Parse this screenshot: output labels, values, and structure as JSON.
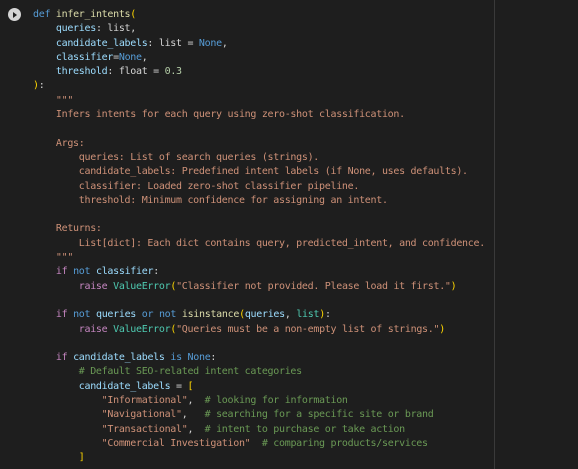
{
  "run_button": {
    "icon": "play-icon"
  },
  "code": {
    "lines": [
      [
        {
          "t": "def",
          "c": "kw"
        },
        {
          "t": " "
        },
        {
          "t": "infer_intents",
          "c": "fn"
        },
        {
          "t": "(",
          "c": "brk"
        }
      ],
      [
        {
          "t": "    "
        },
        {
          "t": "queries",
          "c": "param"
        },
        {
          "t": ": list,"
        }
      ],
      [
        {
          "t": "    "
        },
        {
          "t": "candidate_labels",
          "c": "param"
        },
        {
          "t": ": list = "
        },
        {
          "t": "None",
          "c": "kw"
        },
        {
          "t": ","
        }
      ],
      [
        {
          "t": "    "
        },
        {
          "t": "classifier",
          "c": "param"
        },
        {
          "t": "="
        },
        {
          "t": "None",
          "c": "kw"
        },
        {
          "t": ","
        }
      ],
      [
        {
          "t": "    "
        },
        {
          "t": "threshold",
          "c": "param"
        },
        {
          "t": ": float = "
        },
        {
          "t": "0.3",
          "c": "num"
        }
      ],
      [
        {
          "t": ")",
          "c": "brk"
        },
        {
          "t": ":"
        }
      ],
      [
        {
          "t": "    \"\"\"",
          "c": "doc"
        }
      ],
      [
        {
          "t": "    Infers intents for each query using zero-shot classification.",
          "c": "doc"
        }
      ],
      [
        {
          "t": ""
        }
      ],
      [
        {
          "t": "    Args:",
          "c": "doc"
        }
      ],
      [
        {
          "t": "        queries: List of search queries (strings).",
          "c": "doc"
        }
      ],
      [
        {
          "t": "        candidate_labels: Predefined intent labels (if None, uses defaults).",
          "c": "doc"
        }
      ],
      [
        {
          "t": "        classifier: Loaded zero-shot classifier pipeline.",
          "c": "doc"
        }
      ],
      [
        {
          "t": "        threshold: Minimum confidence for assigning an intent.",
          "c": "doc"
        }
      ],
      [
        {
          "t": ""
        }
      ],
      [
        {
          "t": "    Returns:",
          "c": "doc"
        }
      ],
      [
        {
          "t": "        List[dict]: Each dict contains query, predicted_intent, and confidence.",
          "c": "doc"
        }
      ],
      [
        {
          "t": "    \"\"\"",
          "c": "doc"
        }
      ],
      [
        {
          "t": "    "
        },
        {
          "t": "if",
          "c": "ctl"
        },
        {
          "t": " "
        },
        {
          "t": "not",
          "c": "kw"
        },
        {
          "t": " "
        },
        {
          "t": "classifier",
          "c": "param"
        },
        {
          "t": ":"
        }
      ],
      [
        {
          "t": "        "
        },
        {
          "t": "raise",
          "c": "ctl"
        },
        {
          "t": " "
        },
        {
          "t": "ValueError",
          "c": "cls"
        },
        {
          "t": "(",
          "c": "brk"
        },
        {
          "t": "\"Classifier not provided. Please load it first.\"",
          "c": "str"
        },
        {
          "t": ")",
          "c": "brk"
        }
      ],
      [
        {
          "t": ""
        }
      ],
      [
        {
          "t": "    "
        },
        {
          "t": "if",
          "c": "ctl"
        },
        {
          "t": " "
        },
        {
          "t": "not",
          "c": "kw"
        },
        {
          "t": " "
        },
        {
          "t": "queries",
          "c": "param"
        },
        {
          "t": " "
        },
        {
          "t": "or",
          "c": "kw"
        },
        {
          "t": " "
        },
        {
          "t": "not",
          "c": "kw"
        },
        {
          "t": " "
        },
        {
          "t": "isinstance",
          "c": "fn"
        },
        {
          "t": "(",
          "c": "brk"
        },
        {
          "t": "queries",
          "c": "param"
        },
        {
          "t": ", "
        },
        {
          "t": "list",
          "c": "cls"
        },
        {
          "t": ")",
          "c": "brk"
        },
        {
          "t": ":"
        }
      ],
      [
        {
          "t": "        "
        },
        {
          "t": "raise",
          "c": "ctl"
        },
        {
          "t": " "
        },
        {
          "t": "ValueError",
          "c": "cls"
        },
        {
          "t": "(",
          "c": "brk"
        },
        {
          "t": "\"Queries must be a non-empty list of strings.\"",
          "c": "str"
        },
        {
          "t": ")",
          "c": "brk"
        }
      ],
      [
        {
          "t": ""
        }
      ],
      [
        {
          "t": "    "
        },
        {
          "t": "if",
          "c": "ctl"
        },
        {
          "t": " "
        },
        {
          "t": "candidate_labels",
          "c": "param"
        },
        {
          "t": " "
        },
        {
          "t": "is",
          "c": "kw"
        },
        {
          "t": " "
        },
        {
          "t": "None",
          "c": "kw"
        },
        {
          "t": ":"
        }
      ],
      [
        {
          "t": "        "
        },
        {
          "t": "# Default SEO-related intent categories",
          "c": "com"
        }
      ],
      [
        {
          "t": "        "
        },
        {
          "t": "candidate_labels",
          "c": "param"
        },
        {
          "t": " = "
        },
        {
          "t": "[",
          "c": "brk"
        }
      ],
      [
        {
          "t": "            "
        },
        {
          "t": "\"Informational\"",
          "c": "str"
        },
        {
          "t": ",  "
        },
        {
          "t": "# looking for information",
          "c": "com"
        }
      ],
      [
        {
          "t": "            "
        },
        {
          "t": "\"Navigational\"",
          "c": "str"
        },
        {
          "t": ",   "
        },
        {
          "t": "# searching for a specific site or brand",
          "c": "com"
        }
      ],
      [
        {
          "t": "            "
        },
        {
          "t": "\"Transactional\"",
          "c": "str"
        },
        {
          "t": ",  "
        },
        {
          "t": "# intent to purchase or take action",
          "c": "com"
        }
      ],
      [
        {
          "t": "            "
        },
        {
          "t": "\"Commercial Investigation\"",
          "c": "str"
        },
        {
          "t": "  "
        },
        {
          "t": "# comparing products/services",
          "c": "com"
        }
      ],
      [
        {
          "t": "        "
        },
        {
          "t": "]",
          "c": "brk"
        }
      ]
    ]
  }
}
